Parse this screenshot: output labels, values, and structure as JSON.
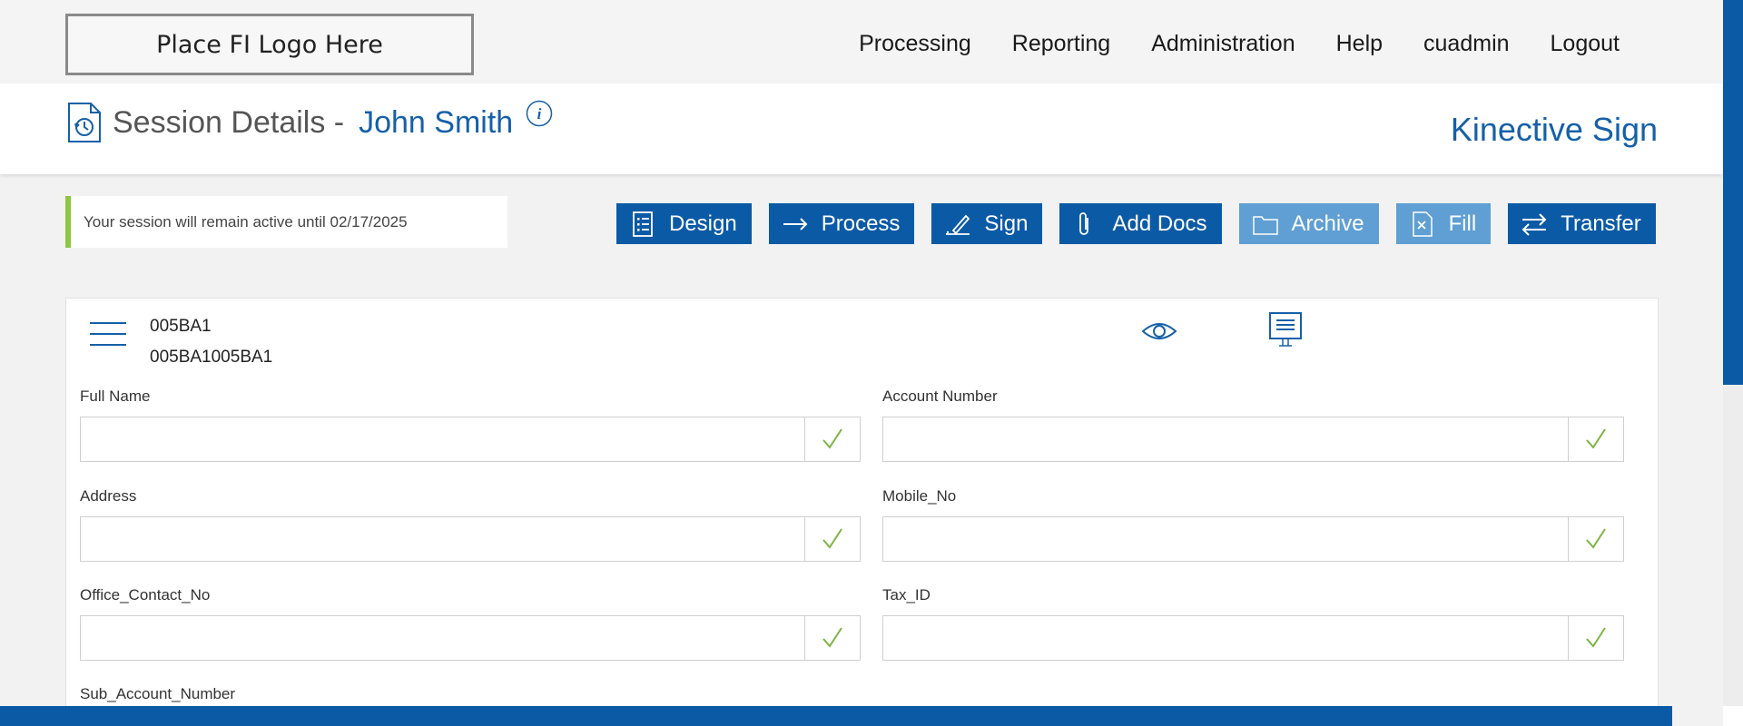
{
  "logo": {
    "text": "Place FI Logo Here"
  },
  "nav": {
    "items": [
      {
        "label": "Processing"
      },
      {
        "label": "Reporting"
      },
      {
        "label": "Administration"
      },
      {
        "label": "Help"
      },
      {
        "label": "cuadmin"
      },
      {
        "label": "Logout"
      }
    ]
  },
  "header": {
    "title": "Session Details -",
    "name": "John Smith",
    "brand": "Kinective Sign"
  },
  "notice": {
    "text": "Your session will remain active until 02/17/2025"
  },
  "actions": {
    "design": "Design",
    "process": "Process",
    "sign": "Sign",
    "add_docs": "Add Docs",
    "archive": "Archive",
    "fill": "Fill",
    "transfer": "Transfer"
  },
  "document": {
    "code": "005BA1",
    "full_code": "005BA1005BA1"
  },
  "fields": {
    "full_name": {
      "label": "Full Name",
      "value": ""
    },
    "account_number": {
      "label": "Account Number",
      "value": ""
    },
    "address": {
      "label": "Address",
      "value": ""
    },
    "mobile_no": {
      "label": "Mobile_No",
      "value": ""
    },
    "office_contact_no": {
      "label": "Office_Contact_No",
      "value": ""
    },
    "tax_id": {
      "label": "Tax_ID",
      "value": ""
    },
    "sub_account_number": {
      "label": "Sub_Account_Number",
      "value": ""
    }
  },
  "colors": {
    "primary": "#0b5aa6",
    "primary_disabled": "#5f9fd3",
    "accent_green": "#8dc63f",
    "title_blue": "#1560a8"
  },
  "icons": {
    "session": "history-document-icon",
    "info": "info-icon",
    "menu": "hamburger-icon",
    "preview": "eye-icon",
    "present": "monitor-icon",
    "valid": "check-icon"
  }
}
